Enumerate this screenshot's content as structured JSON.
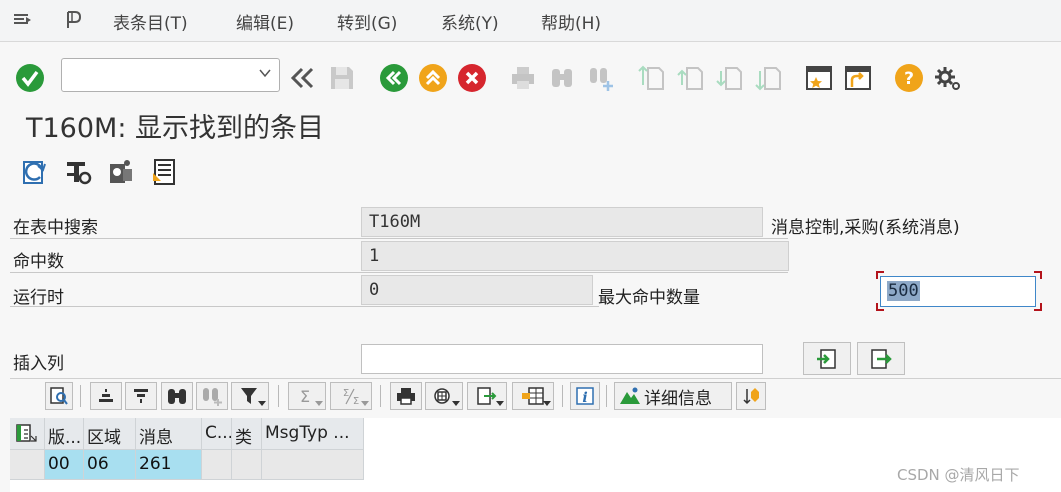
{
  "menu": {
    "items": [
      "表条目(T)",
      "编辑(E)",
      "转到(G)",
      "系统(Y)",
      "帮助(H)"
    ]
  },
  "toolbar": {
    "command_field_value": ""
  },
  "page": {
    "title": "T160M: 显示找到的条目"
  },
  "form": {
    "search_in_table_label": "在表中搜索",
    "search_in_table_value": "T160M",
    "table_description": "消息控制,采购(系统消息)",
    "hits_label": "命中数",
    "hits_value": "1",
    "runtime_label": "运行时",
    "runtime_value": "0",
    "max_hits_label": "最大命中数量",
    "max_hits_value": "500",
    "insert_column_label": "插入列",
    "insert_column_value": ""
  },
  "alv_toolbar": {
    "details_label": "详细信息"
  },
  "table": {
    "columns": [
      "版...",
      "区域",
      "消息",
      "C...",
      "类",
      "MsgTyp ..."
    ],
    "rows": [
      [
        "00",
        "06",
        "261",
        "",
        "",
        ""
      ]
    ]
  },
  "watermark": "CSDN @清风日下",
  "colors": {
    "accent_green": "#2a9a3a",
    "accent_orange": "#f0a41a",
    "accent_red": "#d6262e",
    "selected_row": "#a8dff0"
  }
}
